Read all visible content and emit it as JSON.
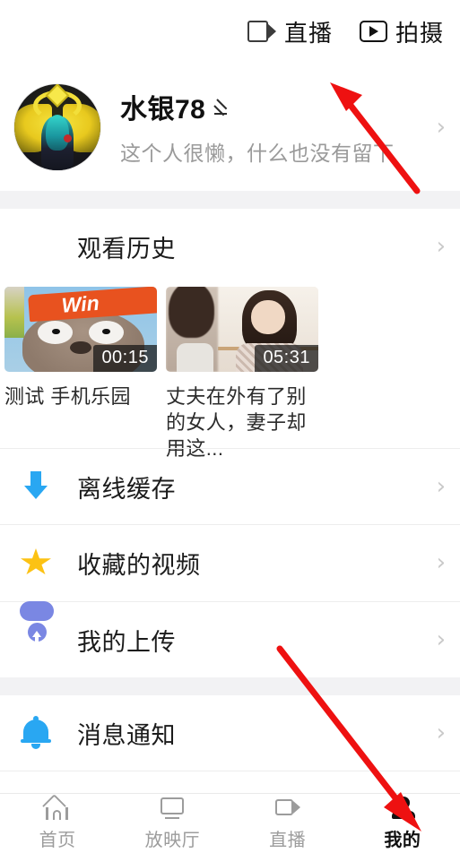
{
  "topbar": {
    "actions": [
      {
        "label": "直播",
        "icon": "video-camera-icon"
      },
      {
        "label": "拍摄",
        "icon": "play-box-icon"
      }
    ]
  },
  "profile": {
    "avatar_alt": "user-avatar",
    "name": "水银78",
    "edit_icon": "pencil-icon",
    "bio": "这个人很懒，什么也没有留下",
    "chevron": "›"
  },
  "history": {
    "label": "观看历史",
    "icon": "clock-icon",
    "chevron": "›",
    "videos": [
      {
        "title": "测试 手机乐园",
        "duration": "00:15",
        "thumb": "cartoon-win-headband-thumbnail"
      },
      {
        "title": "丈夫在外有了别的女人，妻子却用这...",
        "duration": "05:31",
        "thumb": "woman-indoor-thumbnail"
      }
    ]
  },
  "menu": [
    {
      "label": "离线缓存",
      "icon": "download-arrow-icon",
      "chevron": "›"
    },
    {
      "label": "收藏的视频",
      "icon": "star-icon",
      "chevron": "›"
    },
    {
      "label": "我的上传",
      "icon": "cloud-upload-icon",
      "chevron": "›"
    },
    {
      "label": "消息通知",
      "icon": "bell-icon",
      "chevron": "›"
    }
  ],
  "bottomnav": {
    "items": [
      {
        "label": "首页",
        "icon": "home-icon",
        "active": false
      },
      {
        "label": "放映厅",
        "icon": "screen-icon",
        "active": false
      },
      {
        "label": "直播",
        "icon": "video-camera-icon",
        "active": false
      },
      {
        "label": "我的",
        "icon": "person-icon",
        "active": true
      }
    ]
  },
  "annotations": {
    "arrow_color": "#ee1111",
    "arrows": [
      {
        "name": "arrow-to-profile",
        "direction": "up-left"
      },
      {
        "name": "arrow-to-my-tab",
        "direction": "down-right"
      }
    ]
  },
  "colors": {
    "clock": "#7a87e3",
    "download": "#29a7f2",
    "star": "#fcc214",
    "cloud": "#7a87e3",
    "bell": "#29a7f2",
    "divider": "#f2f2f4",
    "nav_inactive": "#9c9c9c",
    "nav_active": "#111111"
  }
}
